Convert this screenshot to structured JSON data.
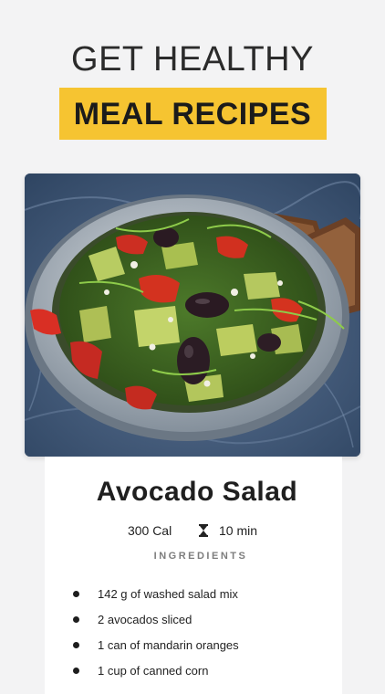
{
  "header": {
    "line1": "GET HEALTHY",
    "line2": "MEAL RECIPES",
    "highlight_color": "#f6c431"
  },
  "recipe": {
    "title": "Avocado Salad",
    "calories": "300 Cal",
    "time": "10 min",
    "time_icon": "hourglass-icon",
    "ingredients_label": "INGREDIENTS",
    "ingredients": [
      "142 g of washed salad mix",
      "2 avocados sliced",
      "1 can of mandarin oranges",
      "1 cup of canned corn"
    ]
  }
}
